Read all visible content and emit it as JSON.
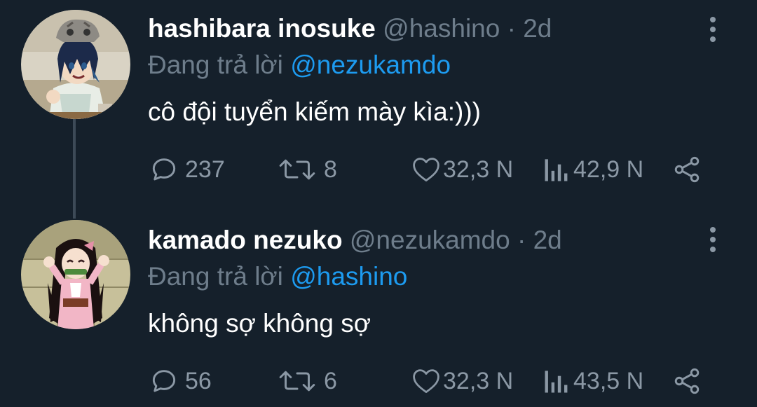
{
  "tweets": [
    {
      "display_name": "hashibara inosuke",
      "handle": "@hashino",
      "separator": "·",
      "time": "2d",
      "reply_prefix": "Đang trả lời",
      "reply_to": "@nezukamdo",
      "text": "cô đội tuyển kiếm mày kìa:)))",
      "replies": "237",
      "retweets": "8",
      "likes": "32,3 N",
      "views": "42,9 N"
    },
    {
      "display_name": "kamado nezuko",
      "handle": "@nezukamdo",
      "separator": "·",
      "time": "2d",
      "reply_prefix": "Đang trả lời",
      "reply_to": "@hashino",
      "text": "không sợ không sợ",
      "replies": "56",
      "retweets": "6",
      "likes": "32,3 N",
      "views": "43,5 N"
    }
  ],
  "colors": {
    "background": "#15202b",
    "secondary_text": "#6e7d8b",
    "icon": "#8b98a5",
    "mention": "#1d9bf0",
    "thread_line": "#3d4a57"
  },
  "icons": [
    "reply-icon",
    "retweet-icon",
    "like-icon",
    "views-icon",
    "share-icon",
    "more-icon"
  ]
}
